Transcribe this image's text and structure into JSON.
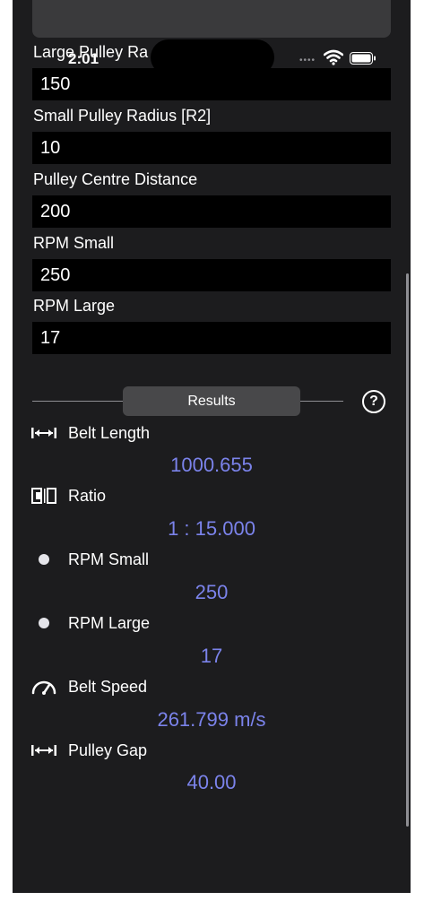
{
  "status": {
    "time": "2:01"
  },
  "inputs": [
    {
      "label": "Large Pulley Ra",
      "value": "150"
    },
    {
      "label": "Small Pulley Radius [R2]",
      "value": "10"
    },
    {
      "label": "Pulley Centre Distance",
      "value": "200"
    },
    {
      "label": "RPM Small",
      "value": "250"
    },
    {
      "label": "RPM Large",
      "value": "17"
    }
  ],
  "results": {
    "tab_label": "Results",
    "help_symbol": "?",
    "items": [
      {
        "icon": "width-arrows-icon",
        "label": "Belt Length",
        "value": "1000.655"
      },
      {
        "icon": "ratio-icon",
        "label": "Ratio",
        "value": "1 : 15.000"
      },
      {
        "icon": "dot-icon",
        "label": "RPM Small",
        "value": "250"
      },
      {
        "icon": "dot-icon",
        "label": "RPM Large",
        "value": "17"
      },
      {
        "icon": "speedometer-icon",
        "label": "Belt Speed",
        "value": "261.799 m/s"
      },
      {
        "icon": "width-arrows-icon",
        "label": "Pulley Gap",
        "value": "40.00"
      }
    ]
  },
  "colors": {
    "accent": "#7b83eb",
    "background": "#1c1c1e",
    "field": "#000000"
  }
}
